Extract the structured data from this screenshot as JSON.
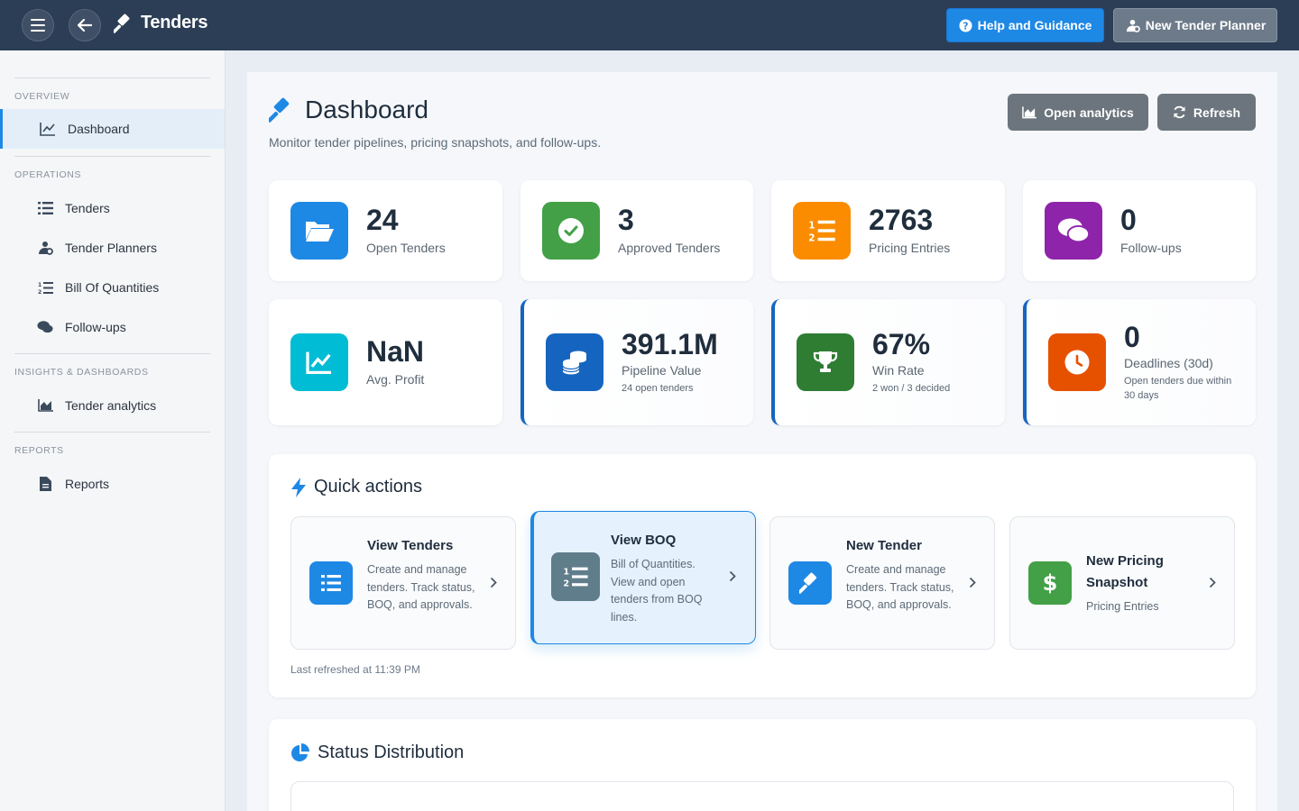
{
  "topbar": {
    "app_title": "Tenders",
    "help_label": "Help and Guidance",
    "planner_label": "New Tender Planner"
  },
  "sidebar": {
    "sections": [
      {
        "heading": "OVERVIEW",
        "items": [
          {
            "label": "Dashboard",
            "icon": "line-chart-icon",
            "active": true
          }
        ]
      },
      {
        "heading": "OPERATIONS",
        "items": [
          {
            "label": "Tenders",
            "icon": "list-icon"
          },
          {
            "label": "Tender Planners",
            "icon": "users-cog-icon"
          },
          {
            "label": "Bill Of Quantities",
            "icon": "numbered-list-icon"
          },
          {
            "label": "Follow-ups",
            "icon": "comments-icon"
          }
        ]
      },
      {
        "heading": "INSIGHTS & DASHBOARDS",
        "items": [
          {
            "label": "Tender analytics",
            "icon": "area-chart-icon"
          }
        ]
      },
      {
        "heading": "REPORTS",
        "items": [
          {
            "label": "Reports",
            "icon": "file-icon"
          }
        ]
      }
    ]
  },
  "page": {
    "title": "Dashboard",
    "subtitle": "Monitor tender pipelines, pricing snapshots, and follow-ups.",
    "open_analytics_label": "Open analytics",
    "refresh_label": "Refresh"
  },
  "stats": [
    {
      "value": "24",
      "label": "Open Tenders",
      "icon": "folder-open-icon",
      "color": "#1e88e5"
    },
    {
      "value": "3",
      "label": "Approved Tenders",
      "icon": "check-circle-icon",
      "color": "#43a047"
    },
    {
      "value": "2763",
      "label": "Pricing Entries",
      "icon": "numbered-list-icon",
      "color": "#fb8c00"
    },
    {
      "value": "0",
      "label": "Follow-ups",
      "icon": "comments-icon",
      "color": "#8e24aa"
    },
    {
      "value": "NaN",
      "label": "Avg. Profit",
      "icon": "line-chart-icon",
      "color": "#00bcd4"
    },
    {
      "value": "391.1M",
      "label": "Pipeline Value",
      "sub": "24 open tenders",
      "icon": "coins-icon",
      "color": "#1565c0"
    },
    {
      "value": "67%",
      "label": "Win Rate",
      "sub": "2 won / 3 decided",
      "icon": "trophy-icon",
      "color": "#2e7d32"
    },
    {
      "value": "0",
      "label": "Deadlines (30d)",
      "sub": "Open tenders due within 30 days",
      "icon": "clock-icon",
      "color": "#e65100"
    }
  ],
  "quick_actions": {
    "title": "Quick actions",
    "items": [
      {
        "title": "View Tenders",
        "desc": "Create and manage tenders. Track status, BOQ, and approvals.",
        "icon": "list-icon",
        "color": "#1e88e5"
      },
      {
        "title": "View BOQ",
        "desc": "Bill of Quantities. View and open tenders from BOQ lines.",
        "icon": "numbered-list-icon",
        "color": "#607d8b"
      },
      {
        "title": "New Tender",
        "desc": "Create and manage tenders. Track status, BOQ, and approvals.",
        "icon": "gavel-icon",
        "color": "#1e88e5"
      },
      {
        "title": "New Pricing Snapshot",
        "desc": "Pricing Entries",
        "icon": "dollar-icon",
        "color": "#43a047"
      }
    ],
    "last_refreshed": "Last refreshed at 11:39 PM"
  },
  "status_distribution": {
    "title": "Status Distribution"
  }
}
